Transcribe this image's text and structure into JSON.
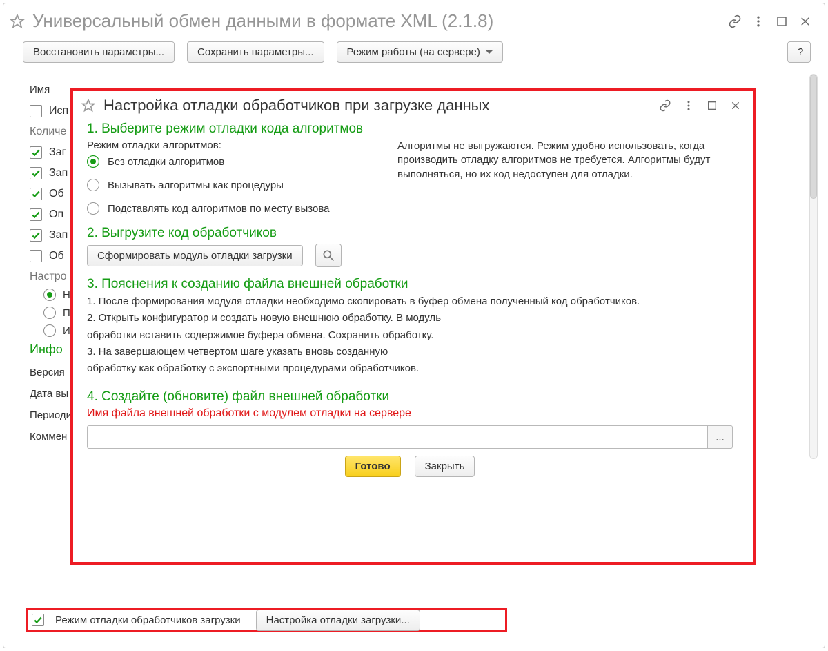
{
  "bg": {
    "title": "Универсальный обмен данными в формате XML (2.1.8)",
    "buttons": {
      "restore": "Восстановить параметры...",
      "save": "Сохранить параметры...",
      "mode": "Режим работы (на сервере)",
      "help": "?"
    },
    "fields": {
      "name_label": "Имя",
      "use_label": "Исп",
      "count_label": "Количе",
      "load": "Заг",
      "record": "Зап",
      "obj": "Об",
      "opt": "Оп",
      "record2": "Зап",
      "obr": "Об",
      "config": "Настро",
      "radio_no": "Не",
      "radio_per": "Пер",
      "radio_isp": "Исп",
      "info_h": "Инфо",
      "version": "Версия",
      "date": "Дата вы",
      "period": "Периоди",
      "comment": "Коммен"
    },
    "bottom": {
      "chk_label": "Режим отладки обработчиков загрузки",
      "btn_label": "Настройка отладки загрузки..."
    }
  },
  "dlg": {
    "title": "Настройка отладки обработчиков при загрузке данных",
    "step1": "1. Выберите режим отладки кода алгоритмов",
    "mode_label": "Режим отладки алгоритмов:",
    "radios": {
      "r0": "Без отладки алгоритмов",
      "r1": "Вызывать алгоритмы как процедуры",
      "r2": "Подставлять код алгоритмов по месту вызова"
    },
    "mode_desc": "Алгоритмы не выгружаются. Режим удобно использовать, когда производить отладку алгоритмов не требуется. Алгоритмы будут выполняться, но их код недоступен для отладки.",
    "step2": "2. Выгрузите код обработчиков",
    "gen_btn": "Сформировать модуль отладки загрузки",
    "step3": "3. Пояснения к созданию файла внешней обработки",
    "p1": "1. После формирования модуля отладки необходимо скопировать в буфер обмена полученный код обработчиков.",
    "p2a": "2. Открыть конфигуратор и создать новую внешнюю обработку. В модуль",
    "p2b": "обработки вставить содержимое буфера обмена. Сохранить обработку.",
    "p3a": "3. На завершающем четвертом шаге указать вновь созданную",
    "p3b": "обработку как обработку с экспортными процедурами обработчиков.",
    "step4": "4. Создайте (обновите) файл внешней обработки",
    "file_label": "Имя файла внешней обработки с модулем отладки на сервере",
    "file_pick": "...",
    "done": "Готово",
    "close": "Закрыть"
  }
}
